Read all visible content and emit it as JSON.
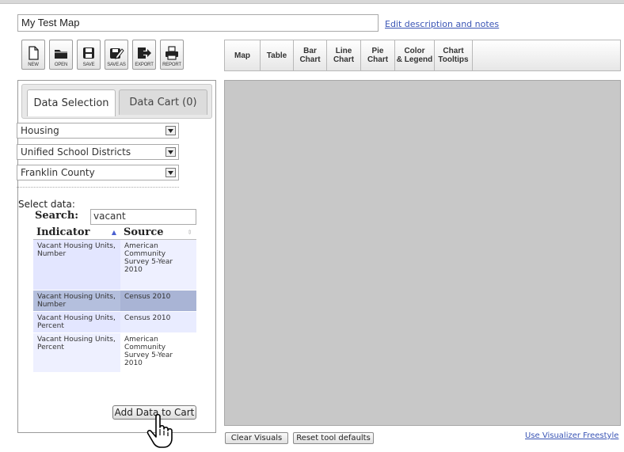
{
  "header": {
    "map_title": "My Test Map",
    "edit_link": "Edit description and notes"
  },
  "toolbar": [
    {
      "label": "NEW",
      "icon": "new-file-icon"
    },
    {
      "label": "OPEN",
      "icon": "open-folder-icon"
    },
    {
      "label": "SAVE",
      "icon": "save-icon"
    },
    {
      "label": "SAVE AS",
      "icon": "save-as-icon"
    },
    {
      "label": "EXPORT",
      "icon": "export-icon"
    },
    {
      "label": "REPORT",
      "icon": "printer-icon"
    }
  ],
  "viz_tabs": [
    "Map",
    "Table",
    "Bar\nChart",
    "Line\nChart",
    "Pie\nChart",
    "Color\n& Legend",
    "Chart\nTooltips"
  ],
  "left_panel": {
    "tabs": {
      "active": "Data Selection",
      "inactive": "Data Cart (0)"
    },
    "dropdowns": {
      "topic": "Housing",
      "geography": "Unified School Districts",
      "region": "Franklin County"
    },
    "select_label": "Select data:",
    "search_label": "Search:",
    "search_value": "vacant",
    "table": {
      "headers": [
        "Indicator",
        "Source"
      ],
      "rows": [
        {
          "indicator": "Vacant Housing Units, Number",
          "source": "American Community Survey 5-Year 2010"
        },
        {
          "indicator": "Vacant Housing Units, Number",
          "source": "Census 2010"
        },
        {
          "indicator": "Vacant Housing Units, Percent",
          "source": "Census 2010"
        },
        {
          "indicator": "Vacant Housing Units, Percent",
          "source": "American Community Survey 5-Year 2010"
        }
      ]
    },
    "add_button": "Add Data to Cart"
  },
  "bottom": {
    "clear_visuals": "Clear Visuals",
    "reset_defaults": "Reset tool defaults",
    "freestyle_link": "Use Visualizer Freestyle"
  },
  "colors": {
    "visual_bg": "#c8c8c8",
    "link": "#3a55b5",
    "row_selected": "#b4bfdd",
    "row_highlight": "#e3e6ff"
  }
}
